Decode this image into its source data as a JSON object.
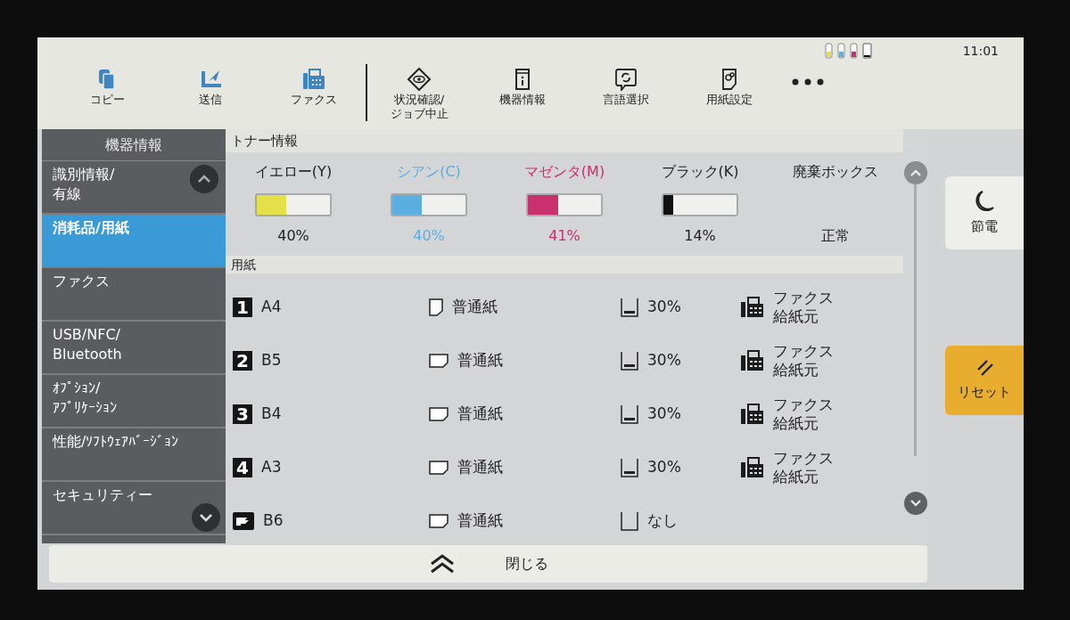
{
  "status_bar": {
    "time": "11:01"
  },
  "nav": [
    {
      "label": "コピー"
    },
    {
      "label": "送信"
    },
    {
      "label": "ファクス"
    },
    {
      "label": "状況確認/\nジョブ中止"
    },
    {
      "label": "機器情報"
    },
    {
      "label": "言語選択"
    },
    {
      "label": "用紙設定"
    }
  ],
  "sidebar": {
    "title": "機器情報",
    "items": [
      {
        "label": "識別情報/\n有線",
        "selected": false
      },
      {
        "label": "消耗品/用紙",
        "selected": true
      },
      {
        "label": "ファクス",
        "selected": false
      },
      {
        "label": "USB/NFC/\nBluetooth",
        "selected": false
      },
      {
        "label": "ｵﾌﾟｼｮﾝ/\nｱﾌﾟﾘｹｰｼｮﾝ",
        "selected": false
      },
      {
        "label": "性能/ｿﾌﾄｳｪｱﾊﾞｰｼﾞｮﾝ",
        "selected": false
      },
      {
        "label": "セキュリティー",
        "selected": false
      }
    ]
  },
  "toner": {
    "title": "トナー情報",
    "items": [
      {
        "kind": "meter",
        "label": "イエロー(Y)",
        "color": "#e3e04a",
        "tinted": false,
        "level": 0.4,
        "reading": "40%"
      },
      {
        "kind": "meter",
        "label": "シアン(C)",
        "color": "#5aaee0",
        "tinted": true,
        "level": 0.4,
        "reading": "40%"
      },
      {
        "kind": "meter",
        "label": "マゼンタ(M)",
        "color": "#c8306e",
        "tinted": true,
        "level": 0.41,
        "reading": "41%"
      },
      {
        "kind": "meter",
        "label": "ブラック(K)",
        "color": "#111111",
        "tinted": false,
        "level": 0.14,
        "reading": "14%"
      },
      {
        "kind": "status",
        "label": "廃棄ボックス",
        "reading": "正常"
      }
    ]
  },
  "paper": {
    "title": "用紙",
    "rows": [
      {
        "kind": "numbered",
        "tray": "1",
        "size": "A4",
        "portrait": true,
        "type": "普通紙",
        "loaded": true,
        "remaining": "30%",
        "source": "ファクス給紙元"
      },
      {
        "kind": "numbered",
        "tray": "2",
        "size": "B5",
        "portrait": false,
        "type": "普通紙",
        "loaded": true,
        "remaining": "30%",
        "source": "ファクス給紙元"
      },
      {
        "kind": "numbered",
        "tray": "3",
        "size": "B4",
        "portrait": false,
        "type": "普通紙",
        "loaded": true,
        "remaining": "30%",
        "source": "ファクス給紙元"
      },
      {
        "kind": "numbered",
        "tray": "4",
        "size": "A3",
        "portrait": false,
        "type": "普通紙",
        "loaded": true,
        "remaining": "30%",
        "source": "ファクス給紙元"
      },
      {
        "kind": "bypass",
        "size": "B6",
        "portrait": false,
        "type": "普通紙",
        "loaded": false,
        "remaining": "なし"
      }
    ]
  },
  "side_buttons": [
    {
      "label": "節電"
    },
    {
      "label": "リセット"
    }
  ],
  "footer": {
    "label": "閉じる"
  }
}
